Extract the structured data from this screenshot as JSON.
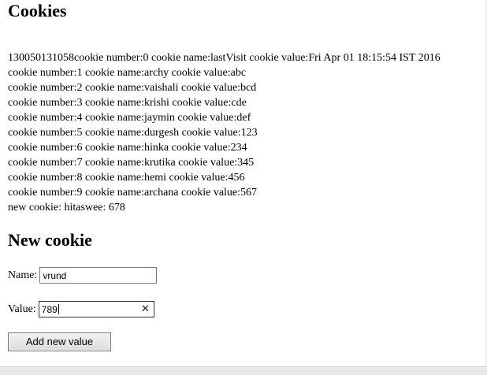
{
  "headings": {
    "cookies": "Cookies",
    "new_cookie": "New cookie"
  },
  "cookie_list": [
    "130050131058cookie number:0 cookie name:lastVisit cookie value:Fri Apr 01 18:15:54 IST 2016",
    "cookie number:1 cookie name:archy cookie value:abc",
    "cookie number:2 cookie name:vaishali cookie value:bcd",
    "cookie number:3 cookie name:krishi cookie value:cde",
    "cookie number:4 cookie name:jaymin cookie value:def",
    "cookie number:5 cookie name:durgesh cookie value:123",
    "cookie number:6 cookie name:hinka cookie value:234",
    "cookie number:7 cookie name:krutika cookie value:345",
    "cookie number:8 cookie name:hemi cookie value:456",
    "cookie number:9 cookie name:archana cookie value:567",
    "new cookie: hitaswee: 678"
  ],
  "form": {
    "name_label": "Name:",
    "name_value": "vrund",
    "value_label": "Value:",
    "value_value": "789",
    "clear_glyph": "✕",
    "submit_label": "Add new value"
  }
}
